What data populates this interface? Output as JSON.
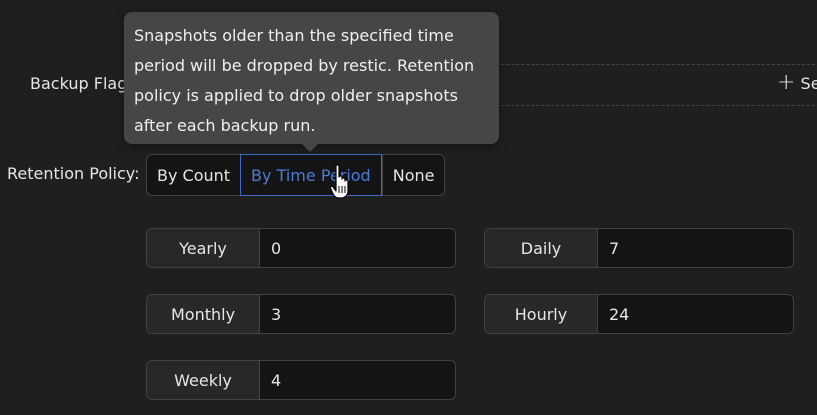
{
  "backup_flags": {
    "label": "Backup Flag",
    "add_label": "Se"
  },
  "retention": {
    "label": "Retention Policy:",
    "options": [
      "By Count",
      "By Time Period",
      "None"
    ],
    "selected": "By Time Period"
  },
  "tooltip": {
    "lines": [
      "Snapshots older than the specified time",
      "period will be dropped by restic. Retention",
      "policy is applied to drop older snapshots",
      "after each backup run."
    ]
  },
  "periods": {
    "yearly": {
      "label": "Yearly",
      "value": "0"
    },
    "monthly": {
      "label": "Monthly",
      "value": "3"
    },
    "weekly": {
      "label": "Weekly",
      "value": "4"
    },
    "daily": {
      "label": "Daily",
      "value": "7"
    },
    "hourly": {
      "label": "Hourly",
      "value": "24"
    }
  },
  "colors": {
    "background": "#1f1f1f",
    "accent": "#3c6bc9",
    "tooltip_bg": "#464646"
  },
  "icons": {
    "add": "plus-icon",
    "cursor": "hand-pointer-icon"
  }
}
